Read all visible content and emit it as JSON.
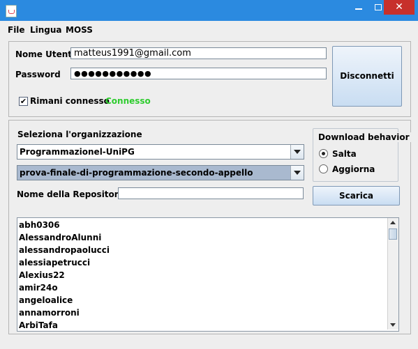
{
  "window": {
    "title": "",
    "minimize_glyph": "",
    "maximize_glyph": "",
    "close_glyph": "✕"
  },
  "menu": {
    "items": [
      "File",
      "Lingua",
      "MOSS"
    ]
  },
  "login": {
    "user_label": "Nome Utente",
    "user_value": "matteus1991@gmail.com",
    "password_label": "Password",
    "password_value": "●●●●●●●●●●●",
    "remember_label": "Rimani connesso",
    "remember_checked": "✔",
    "status_text": "Connesso",
    "status_color": "#2ecc2e",
    "disconnect_label": "Disconnetti"
  },
  "repo": {
    "org_label": "Seleziona l'organizzazione",
    "org_selected": "Programmazionel-UniPG",
    "repo_selected": "prova-finale-di-programmazione-secondo-appello",
    "repo_name_label": "Nome della Repository",
    "repo_name_value": "",
    "download_button": "Scarica"
  },
  "download_behavior": {
    "title": "Download behavior",
    "options": [
      "Salta",
      "Aggiorna"
    ],
    "selected": "Salta"
  },
  "users": [
    "abh0306",
    "AlessandroAlunni",
    "alessandropaolucci",
    "alessiapetrucci",
    "Alexius22",
    "amir24o",
    "angeloalice",
    "annamorroni",
    "ArbiTafa"
  ]
}
